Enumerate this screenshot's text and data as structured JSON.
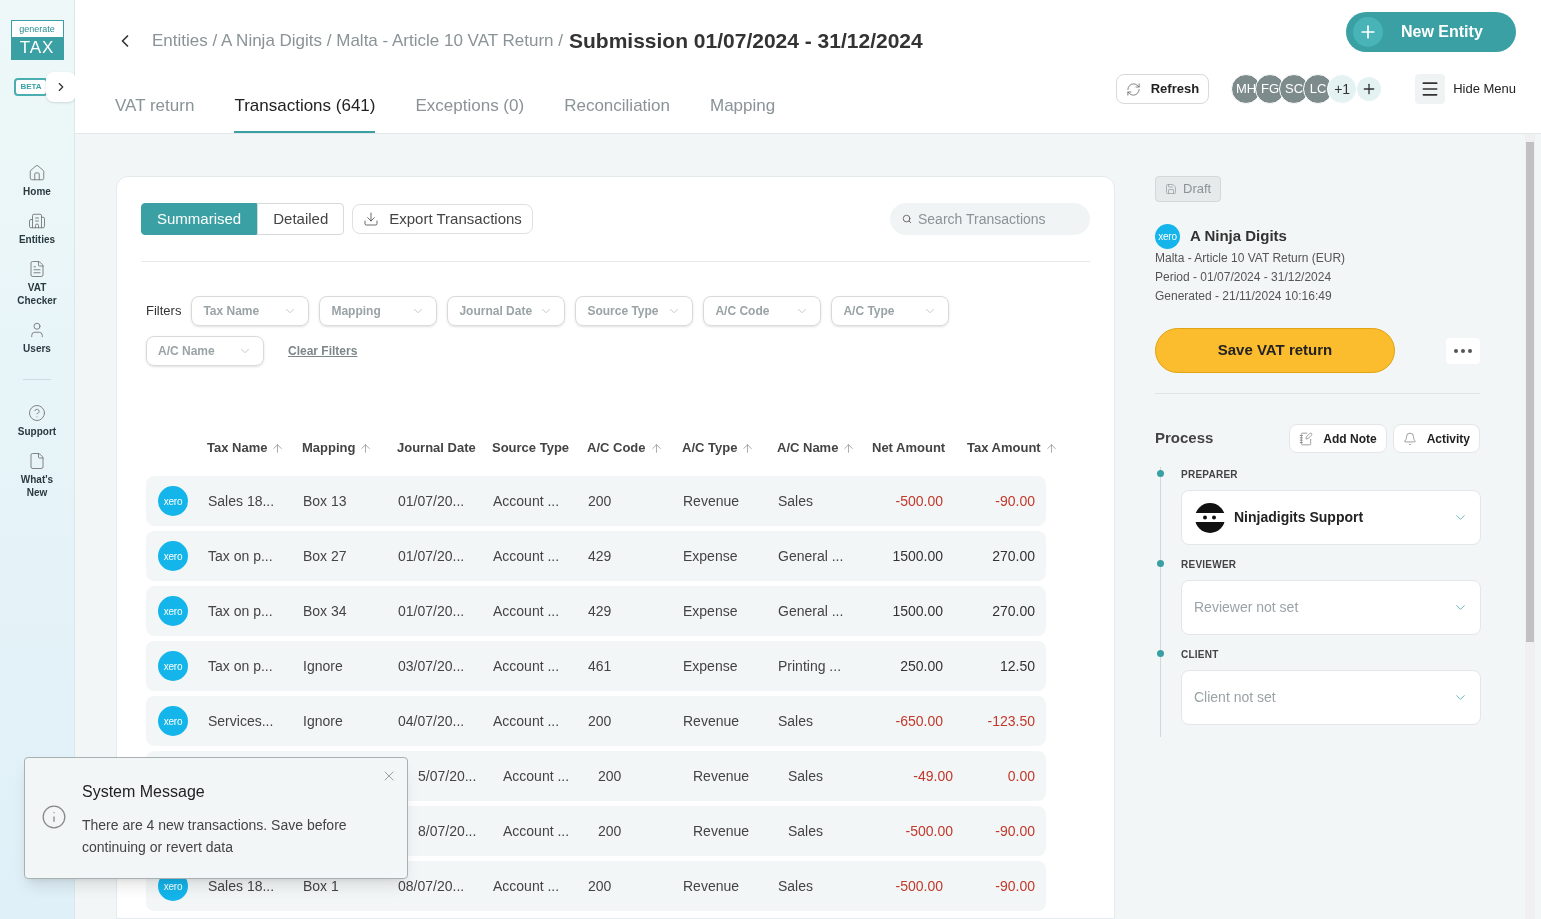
{
  "logo": {
    "top": "generate",
    "main": "TAX",
    "badge": "BETA"
  },
  "nav": [
    {
      "label": "Home",
      "kind": "home"
    },
    {
      "label": "Entities",
      "kind": "entities"
    },
    {
      "label": "VAT Checker",
      "kind": "checker"
    },
    {
      "label": "Users",
      "kind": "users"
    },
    {
      "label": "Support",
      "kind": "support"
    },
    {
      "label": "What's New",
      "kind": "news"
    }
  ],
  "breadcrumb": {
    "path": "Entities / A Ninja Digits / Malta - Article 10 VAT Return /",
    "current": "Submission 01/07/2024 - 31/12/2024"
  },
  "new_entity_button": "New Entity",
  "tabs": [
    {
      "label": "VAT return",
      "selected": false
    },
    {
      "label": "Transactions (641)",
      "selected": true
    },
    {
      "label": "Exceptions (0)",
      "selected": false
    },
    {
      "label": "Reconciliation",
      "selected": false
    },
    {
      "label": "Mapping",
      "selected": false
    }
  ],
  "refresh_button": "Refresh",
  "avatars": [
    "MH",
    "FG",
    "SC",
    "LC"
  ],
  "avatar_more": "+1",
  "hide_menu": "Hide Menu",
  "view_toggle": [
    {
      "label": "Summarised",
      "selected": true
    },
    {
      "label": "Detailed",
      "selected": false
    }
  ],
  "export_button": "Export Transactions",
  "search": {
    "placeholder": "Search Transactions"
  },
  "filters_label": "Filters",
  "filters": [
    "Tax Name",
    "Mapping",
    "Journal Date",
    "Source Type",
    "A/C Code",
    "A/C Type",
    "A/C Name"
  ],
  "clear_filters": "Clear Filters",
  "table": {
    "columns": [
      {
        "label": "Tax Name",
        "sortable": true
      },
      {
        "label": "Mapping",
        "sortable": true
      },
      {
        "label": "Journal Date",
        "sortable": false
      },
      {
        "label": "Source Type",
        "sortable": false
      },
      {
        "label": "A/C Code",
        "sortable": true
      },
      {
        "label": "A/C Type",
        "sortable": true
      },
      {
        "label": "A/C Name",
        "sortable": true
      },
      {
        "label": "Net Amount",
        "sortable": false
      },
      {
        "label": "Tax Amount",
        "sortable": true
      }
    ],
    "rows": [
      {
        "kind": "full",
        "logo": "xero",
        "tax_name": "Sales 18...",
        "mapping": "Box 13",
        "date": "01/07/20...",
        "source": "Account ...",
        "code": "200",
        "type": "Revenue",
        "name": "Sales",
        "net": "-500.00",
        "tax": "-90.00",
        "negative": true
      },
      {
        "kind": "full",
        "logo": "xero",
        "tax_name": "Tax on p...",
        "mapping": "Box 27",
        "date": "01/07/20...",
        "source": "Account ...",
        "code": "429",
        "type": "Expense",
        "name": "General ...",
        "net": "1500.00",
        "tax": "270.00",
        "negative": false
      },
      {
        "kind": "full",
        "logo": "xero",
        "tax_name": "Tax on p...",
        "mapping": "Box 34",
        "date": "01/07/20...",
        "source": "Account ...",
        "code": "429",
        "type": "Expense",
        "name": "General ...",
        "net": "1500.00",
        "tax": "270.00",
        "negative": false
      },
      {
        "kind": "full",
        "logo": "xero",
        "tax_name": "Tax on p...",
        "mapping": "Ignore",
        "date": "03/07/20...",
        "source": "Account ...",
        "code": "461",
        "type": "Expense",
        "name": "Printing ...",
        "net": "250.00",
        "tax": "12.50",
        "negative": false
      },
      {
        "kind": "full",
        "logo": "xero",
        "tax_name": "Services...",
        "mapping": "Ignore",
        "date": "04/07/20...",
        "source": "Account ...",
        "code": "200",
        "type": "Revenue",
        "name": "Sales",
        "net": "-650.00",
        "tax": "-123.50",
        "negative": true
      },
      {
        "kind": "covered",
        "date": "5/07/20...",
        "source": "Account ...",
        "code": "200",
        "type": "Revenue",
        "name": "Sales",
        "net": "-49.00",
        "tax": "0.00",
        "negative": true
      },
      {
        "kind": "covered",
        "date": "8/07/20...",
        "source": "Account ...",
        "code": "200",
        "type": "Revenue",
        "name": "Sales",
        "net": "-500.00",
        "tax": "-90.00",
        "negative": true
      },
      {
        "kind": "full",
        "logo": "xero",
        "tax_name": "Sales 18...",
        "mapping": "Box 1",
        "date": "08/07/20...",
        "source": "Account ...",
        "code": "200",
        "type": "Revenue",
        "name": "Sales",
        "net": "-500.00",
        "tax": "-90.00",
        "negative": true
      }
    ]
  },
  "status_badge": "Draft",
  "entity": {
    "logo": "xero",
    "name": "A Ninja Digits",
    "lines": [
      "Malta - Article 10 VAT Return (EUR)",
      "Period - 01/07/2024 - 31/12/2024",
      "Generated - 21/11/2024 10:16:49"
    ]
  },
  "save_button": "Save VAT return",
  "process": {
    "title": "Process",
    "add_note": "Add Note",
    "activity": "Activity",
    "steps": [
      {
        "label": "PREPARER",
        "value": "Ninjadigits Support",
        "set": true
      },
      {
        "label": "REVIEWER",
        "value": "Reviewer not set",
        "set": false
      },
      {
        "label": "CLIENT",
        "value": "Client not set",
        "set": false
      }
    ]
  },
  "toast": {
    "title": "System Message",
    "message": "There are 4 new transactions. Save before continuing or revert data"
  }
}
